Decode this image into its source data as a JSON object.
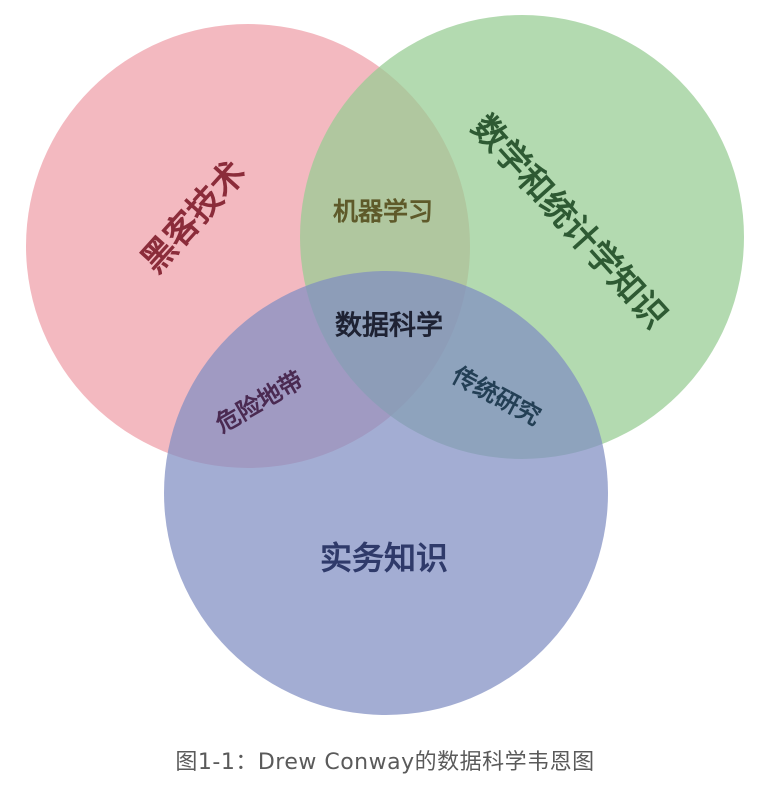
{
  "diagram": {
    "circles": {
      "hacking": {
        "label": "黑客技术",
        "color": "#ee9ea7"
      },
      "math_stats": {
        "label": "数学和统计学知识",
        "color": "#96cc92"
      },
      "substantive": {
        "label": "实务知识",
        "color": "#7f8ec2"
      }
    },
    "overlaps": {
      "machine_learning": "机器学习",
      "danger_zone": "危险地带",
      "traditional_research": "传统研究",
      "data_science": "数据科学"
    }
  },
  "caption": "图1-1：Drew Conway的数据科学韦恩图"
}
